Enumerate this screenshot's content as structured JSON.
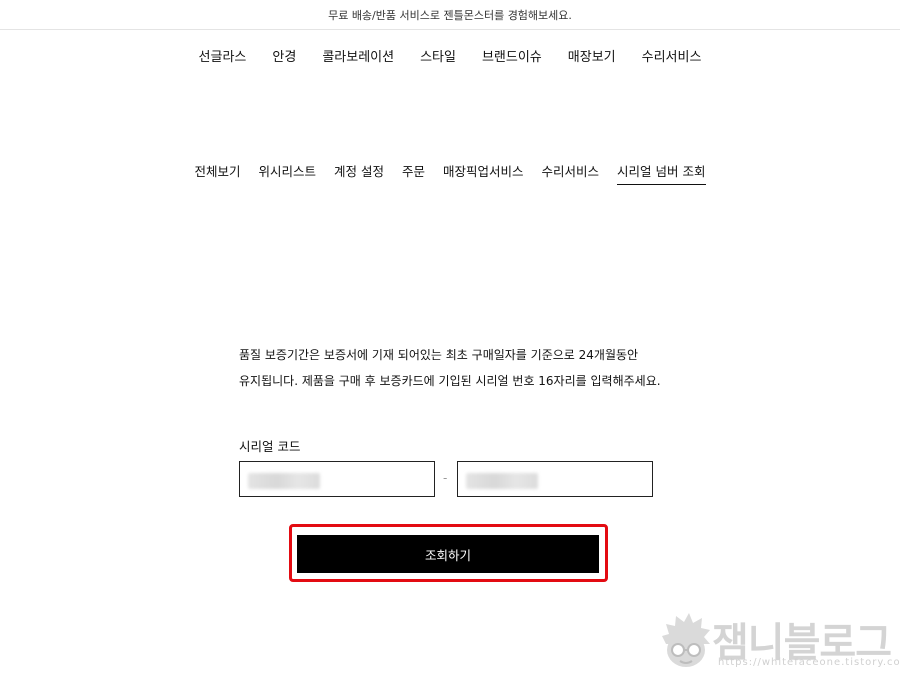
{
  "promo_bar": {
    "text": "무료 배송/반품 서비스로 젠틀몬스터를 경험해보세요."
  },
  "main_nav": {
    "items": [
      "선글라스",
      "안경",
      "콜라보레이션",
      "스타일",
      "브랜드이슈",
      "매장보기",
      "수리서비스"
    ]
  },
  "account_nav": {
    "items": [
      "전체보기",
      "위시리스트",
      "계정 설정",
      "주문",
      "매장픽업서비스",
      "수리서비스",
      "시리얼 넘버 조회"
    ],
    "active_index": 6
  },
  "serial_lookup": {
    "description_line1": "품질 보증기간은 보증서에 기재 되어있는 최초 구매일자를 기준으로 24개월동안",
    "description_line2": "유지됩니다. 제품을 구매 후 보증카드에 기입된 시리얼 번호 16자리를 입력해주세요.",
    "field_label": "시리얼 코드",
    "separator": "-",
    "submit_label": "조회하기"
  },
  "watermark": {
    "text": "잼니블로그",
    "url": "https://whitefaceone.tistory.com"
  },
  "colors": {
    "highlight_border": "#e30b12",
    "button_bg": "#000000",
    "button_text": "#ffffff"
  }
}
